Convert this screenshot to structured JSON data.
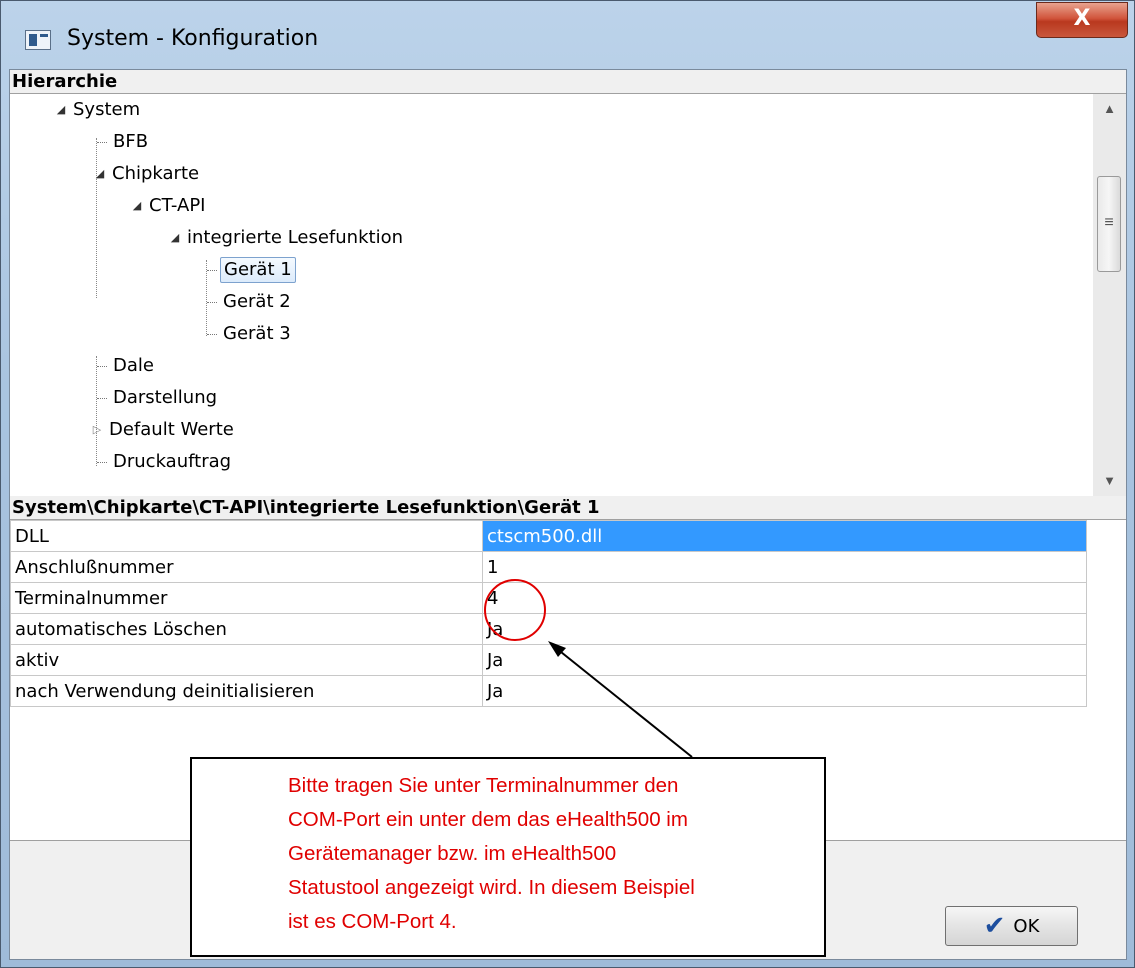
{
  "window": {
    "title": "System - Konfiguration",
    "close_label": "X"
  },
  "hierarchy": {
    "header": "Hierarchie",
    "nodes": [
      {
        "label": "System",
        "state": "expanded"
      },
      {
        "label": "BFB",
        "state": "leaf"
      },
      {
        "label": "Chipkarte",
        "state": "expanded"
      },
      {
        "label": "CT-API",
        "state": "expanded"
      },
      {
        "label": "integrierte Lesefunktion",
        "state": "expanded"
      },
      {
        "label": "Gerät 1",
        "state": "leaf",
        "selected": true
      },
      {
        "label": "Gerät 2",
        "state": "leaf"
      },
      {
        "label": "Gerät 3",
        "state": "leaf"
      },
      {
        "label": "Dale",
        "state": "leaf"
      },
      {
        "label": "Darstellung",
        "state": "leaf"
      },
      {
        "label": "Default Werte",
        "state": "collapsed"
      },
      {
        "label": "Druckauftrag",
        "state": "leaf"
      }
    ],
    "scrollbar_icons": [
      "scroll-up-icon",
      "scroll-grip-icon",
      "scroll-down-icon"
    ]
  },
  "properties": {
    "path_header": "System\\Chipkarte\\CT-API\\integrierte Lesefunktion\\Gerät 1",
    "rows": [
      {
        "key": "DLL",
        "value": "ctscm500.dll",
        "selected": true
      },
      {
        "key": "Anschlußnummer",
        "value": "1"
      },
      {
        "key": "Terminalnummer",
        "value": "4"
      },
      {
        "key": "automatisches Löschen",
        "value": "Ja"
      },
      {
        "key": "aktiv",
        "value": "Ja"
      },
      {
        "key": "nach Verwendung deinitialisieren",
        "value": "Ja"
      }
    ],
    "selection_color": "#3399ff"
  },
  "buttons": {
    "ok_label": "OK",
    "ok_icon": "checkmark-icon"
  },
  "annotation": {
    "lines": [
      "Bitte tragen Sie unter Terminalnummer den",
      "COM-Port ein unter dem das eHealth500 im",
      "Gerätemanager bzw. im eHealth500",
      "Statustool angezeigt wird. In diesem Beispiel",
      "ist es COM-Port 4."
    ],
    "color": "#e00000",
    "highlight_color": "#e00000"
  }
}
